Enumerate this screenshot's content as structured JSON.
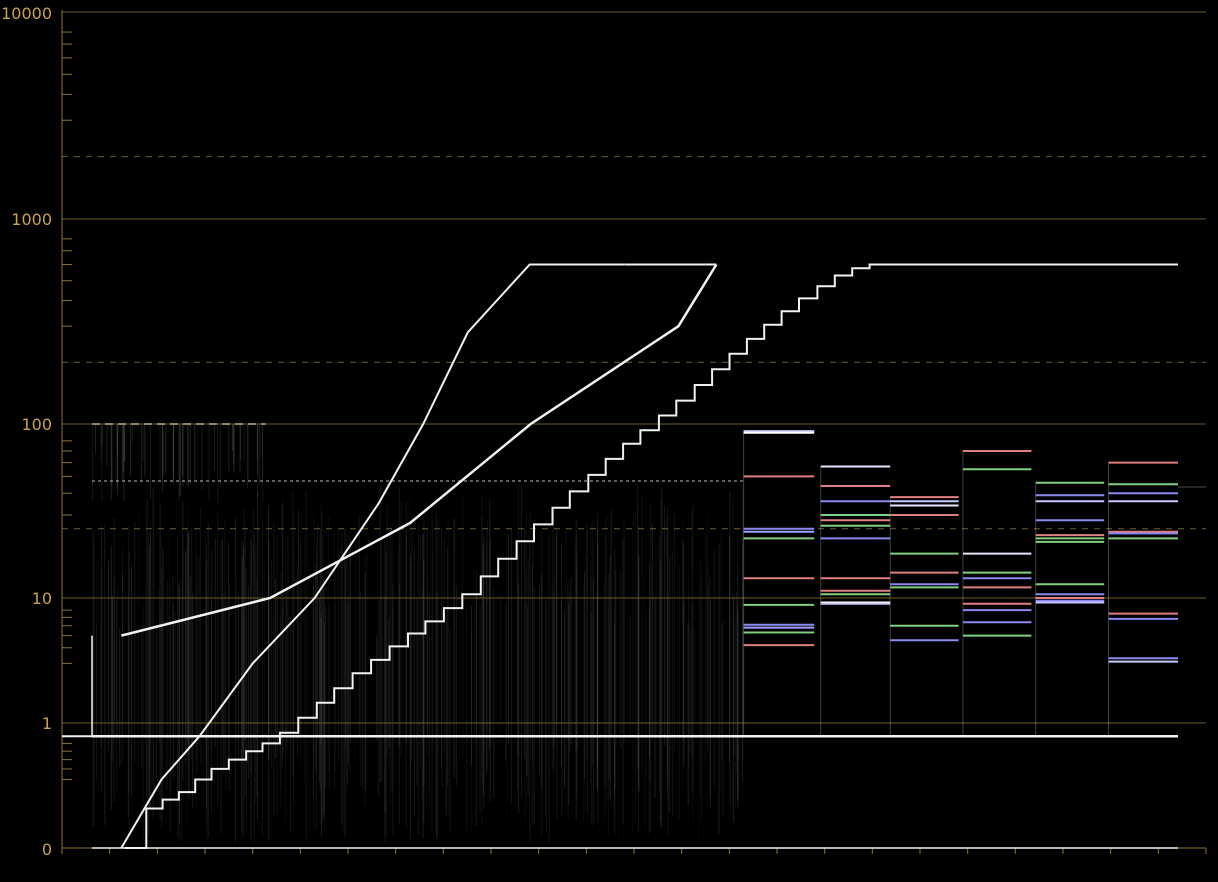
{
  "chart_data": {
    "type": "line",
    "title": "",
    "xlabel": "",
    "ylabel": "",
    "y_scale": "log (nits waveform)",
    "ylim": [
      0,
      10000
    ],
    "xlim": [
      0,
      1
    ],
    "grid": true,
    "y_tick_labels": [
      "10000",
      "1000",
      "100",
      "10",
      "1",
      "0"
    ],
    "y_major_ticks": [
      10000,
      1000,
      100,
      10,
      1
    ],
    "y_dashed_ticks": [
      2000,
      200,
      25
    ],
    "y_minor_ticks": [
      8000,
      7000,
      6000,
      5000,
      4000,
      3000,
      800,
      700,
      600,
      500,
      400,
      300,
      80,
      70,
      60,
      50,
      40,
      30,
      8,
      7,
      6,
      5,
      4,
      3,
      0.8,
      0.7,
      0.6,
      0.5,
      0.4,
      0.3
    ],
    "x_tick_count": 24,
    "series": [
      {
        "style": "continuous",
        "x": [
          0.027,
          0.164,
          0.293,
          0.404,
          0.54,
          0.575
        ],
        "y": [
          5.0,
          10.0,
          27.0,
          100.0,
          300.0,
          600.0
        ]
      },
      {
        "style": "continuous",
        "x": [
          0.027,
          0.064,
          0.099,
          0.148,
          0.205,
          0.264,
          0.305,
          0.346,
          0.403,
          0.49
        ],
        "y": [
          0.0,
          0.3,
          0.8,
          3.0,
          10.0,
          35.0,
          100.0,
          280.0,
          600.0,
          600.0
        ]
      },
      {
        "style": "staircase",
        "x": [
          0.03,
          0.05,
          0.065,
          0.08,
          0.095,
          0.11,
          0.126,
          0.142,
          0.157,
          0.173,
          0.19,
          0.207,
          0.223,
          0.24,
          0.257,
          0.274,
          0.291,
          0.307,
          0.324,
          0.341,
          0.358,
          0.374,
          0.391,
          0.407,
          0.424,
          0.44,
          0.457,
          0.473,
          0.489,
          0.505,
          0.522,
          0.538,
          0.555,
          0.571,
          0.587,
          0.603,
          0.619,
          0.635,
          0.651,
          0.668,
          0.684,
          0.7,
          0.716,
          0.726,
          1.0
        ],
        "y": [
          0.0,
          0.1,
          0.15,
          0.2,
          0.3,
          0.4,
          0.5,
          0.6,
          0.7,
          0.85,
          1.1,
          1.45,
          1.9,
          2.5,
          3.2,
          4.1,
          5.2,
          6.5,
          8.3,
          10.5,
          13.3,
          16.8,
          21.2,
          26.5,
          33.0,
          41.0,
          51.0,
          63.0,
          77.0,
          92.0,
          110.0,
          130.0,
          155.0,
          185.0,
          220.0,
          260.0,
          305.0,
          355.0,
          410.0,
          470.0,
          530.0,
          575.0,
          600.0,
          600.0,
          600.0
        ]
      },
      {
        "style": "flat",
        "x": [
          0.0,
          1.0
        ],
        "y": [
          0.8,
          0.8
        ]
      }
    ],
    "patch_levels": [
      {
        "x": [
          0.6,
          0.665
        ],
        "y": [
          91.0,
          89.0,
          50.0,
          25.0,
          24.0,
          22.0,
          13.0,
          8.8,
          6.1,
          5.8,
          5.3,
          4.2
        ],
        "colors": [
          "#c8c8ff",
          "#ffffff",
          "#e08080",
          "#8a8af0",
          "#9aa6ff",
          "#80d080",
          "#e08080",
          "#80d080",
          "#8a8af0",
          "#a0a0ff",
          "#80d080",
          "#e08080"
        ]
      },
      {
        "x": [
          0.671,
          0.735
        ],
        "y": [
          57.0,
          44.0,
          36.0,
          30.0,
          28.0,
          26.0,
          22.0,
          13.0,
          11.0,
          10.5,
          9.2,
          9.0
        ],
        "colors": [
          "#e6e6ff",
          "#e08080",
          "#8a8af0",
          "#80d080",
          "#e08080",
          "#80d080",
          "#8a8af0",
          "#e08080",
          "#e08080",
          "#80d080",
          "#ffffff",
          "#c8c8ff"
        ]
      },
      {
        "x": [
          0.735,
          0.798
        ],
        "y": [
          38.0,
          36.0,
          34.0,
          30.0,
          18.0,
          14.0,
          12.0,
          11.5,
          6.0,
          4.6
        ],
        "colors": [
          "#e08080",
          "#c8c8ff",
          "#e6e6ff",
          "#e08080",
          "#80d080",
          "#e08080",
          "#8a8af0",
          "#80d080",
          "#80d080",
          "#8a8af0"
        ]
      },
      {
        "x": [
          0.802,
          0.865
        ],
        "y": [
          70.0,
          55.0,
          18.0,
          14.0,
          13.0,
          11.5,
          9.0,
          8.0,
          6.4,
          5.0
        ],
        "colors": [
          "#e08080",
          "#80d080",
          "#e6e6ff",
          "#80d080",
          "#8a8af0",
          "#e08080",
          "#e08080",
          "#8a8af0",
          "#8a8af0",
          "#80d080"
        ]
      },
      {
        "x": [
          0.869,
          0.932
        ],
        "y": [
          46.0,
          39.0,
          36.0,
          28.0,
          23.0,
          22.0,
          21.0,
          12.0,
          10.5,
          10.0,
          9.5,
          9.2
        ],
        "colors": [
          "#80d080",
          "#8a8af0",
          "#c8c8ff",
          "#8a8af0",
          "#e08080",
          "#80d080",
          "#80d080",
          "#80d080",
          "#8a8af0",
          "#e08080",
          "#8a8af0",
          "#c8c8ff"
        ]
      },
      {
        "x": [
          0.936,
          1.0
        ],
        "y": [
          60.0,
          45.0,
          40.0,
          36.0,
          24.0,
          23.5,
          22.0,
          7.5,
          6.8,
          3.3,
          3.1
        ],
        "colors": [
          "#e08080",
          "#80d080",
          "#8a8af0",
          "#c8c8ff",
          "#e08080",
          "#8a8af0",
          "#80d080",
          "#e08080",
          "#8a8af0",
          "#8a8af0",
          "#c8c8ff"
        ]
      }
    ],
    "noise_ceiling_left": 47,
    "noise_ceiling_clip": 100
  },
  "colors": {
    "background": "#000000",
    "grid_major": "#6b5a2a",
    "grid_dashed": "#6e5f32",
    "tick": "#8a7434",
    "label": "#c9a24a",
    "trace": "#f2f2f2"
  }
}
